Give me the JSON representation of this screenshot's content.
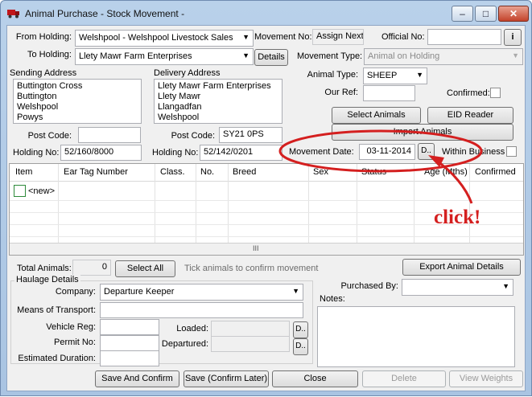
{
  "window": {
    "title": "Animal Purchase - Stock Movement -",
    "controls": [
      "–",
      "□",
      "✕"
    ]
  },
  "icons": {
    "app": "truck-icon",
    "dropdown": "chevron-down-icon"
  },
  "colors": {
    "annotation": "#d41f1f",
    "titlebar": "#b9d1ea"
  },
  "top": {
    "from_holding_label": "From Holding:",
    "from_holding_value": "Welshpool - Welshpool Livestock Sales",
    "movement_no_label": "Movement No:",
    "movement_no_value": "Assign Next",
    "official_no_label": "Official No:",
    "official_no_value": "",
    "info_button": "i",
    "to_holding_label": "To Holding:",
    "to_holding_value": "Llety Mawr Farm Enterprises",
    "details_button": "Details",
    "movement_type_label": "Movement Type:",
    "movement_type_value": "Animal on Holding",
    "animal_type_label": "Animal Type:",
    "animal_type_value": "SHEEP",
    "our_ref_label": "Our Ref:",
    "our_ref_value": "",
    "confirmed_label": "Confirmed:",
    "select_animals_button": "Select Animals",
    "eid_reader_button": "EID Reader",
    "import_animals_button": "Import Animals",
    "movement_date_label": "Movement Date:",
    "movement_date_value": "03-11-2014",
    "date_picker_button": "D..",
    "within_business_label": "Within Business"
  },
  "sending": {
    "header": "Sending Address",
    "lines": [
      "Buttington Cross",
      "Buttington",
      "Welshpool",
      "Powys"
    ],
    "postcode_label": "Post Code:",
    "postcode_value": "",
    "holding_no_label": "Holding No:",
    "holding_no_value": "52/160/8000"
  },
  "delivery": {
    "header": "Delivery Address",
    "lines": [
      "Llety Mawr Farm Enterprises",
      "Llety Mawr",
      "Llangadfan",
      "Welshpool"
    ],
    "postcode_label": "Post Code:",
    "postcode_value": "SY21 0PS",
    "holding_no_label": "Holding No:",
    "holding_no_value": "52/142/0201"
  },
  "grid": {
    "columns": [
      "Item",
      "Ear Tag Number",
      "Class.",
      "No.",
      "Breed",
      "Sex",
      "Status",
      "Age (Mths)",
      "Confirmed"
    ],
    "new_row_label": "<new>",
    "scroll_grip": "III"
  },
  "bottom": {
    "total_animals_label": "Total Animals:",
    "total_animals_value": "0",
    "select_all_button": "Select All",
    "hint": "Tick animals to confirm movement",
    "export_button": "Export Animal Details",
    "haulage_header": "Haulage Details",
    "company_label": "Company:",
    "company_value": "Departure Keeper",
    "means_label": "Means of Transport:",
    "means_value": "",
    "vehicle_reg_label": "Vehicle Reg:",
    "vehicle_reg_value": "",
    "permit_label": "Permit No:",
    "permit_value": "",
    "duration_label": "Estimated Duration:",
    "duration_value": "",
    "loaded_label": "Loaded:",
    "loaded_value": "",
    "departured_label": "Departured:",
    "departured_value": "",
    "loaded_btn": "D..",
    "departured_btn": "D..",
    "purchased_by_label": "Purchased By:",
    "purchased_by_value": "",
    "notes_label": "Notes:",
    "notes_value": ""
  },
  "footer": {
    "save_confirm": "Save And Confirm",
    "save_confirm_later": "Save (Confirm Later)",
    "close": "Close",
    "delete": "Delete",
    "view_weights": "View Weights"
  },
  "annotation": {
    "text": "click!"
  }
}
